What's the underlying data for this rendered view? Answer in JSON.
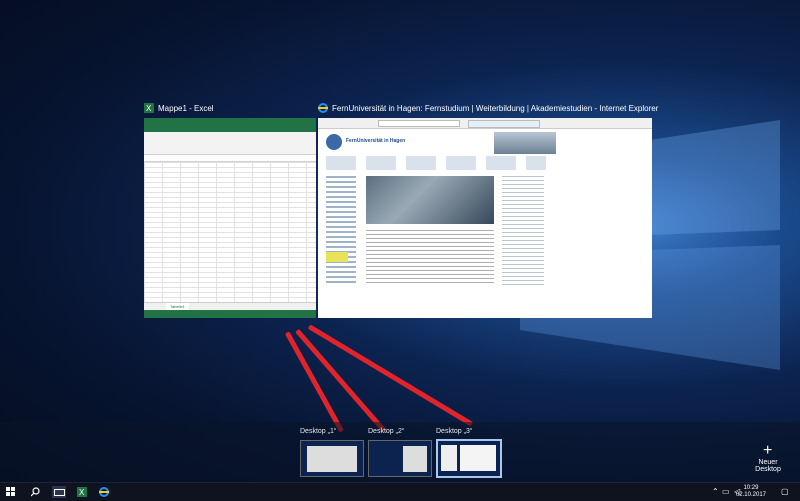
{
  "windows": [
    {
      "title": "Mappe1 - Excel",
      "sheet_tab": "Tabelle1"
    },
    {
      "title": "FernUniversität in Hagen: Fernstudium | Weiterbildung | Akademiestudien - Internet Explorer",
      "site_name": "FernUniversität in Hagen"
    }
  ],
  "desktops": [
    {
      "label": "Desktop „1“"
    },
    {
      "label": "Desktop „2“"
    },
    {
      "label": "Desktop „3“"
    }
  ],
  "new_desktop": {
    "label": "Neuer Desktop"
  },
  "taskbar": {
    "time": "10:29",
    "date": "02.10.2017"
  },
  "colors": {
    "annotation": "#e0242a",
    "excel": "#217346",
    "ie": "#1d4f91"
  }
}
